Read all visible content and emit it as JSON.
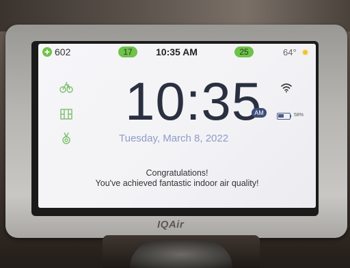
{
  "device": {
    "brand": "IQAir"
  },
  "status_bar": {
    "fan_icon": "fan-icon",
    "fan_speed": "602",
    "indoor_aqi": "17",
    "time": "10:35 AM",
    "outdoor_aqi": "25",
    "temperature": "64°",
    "weather_icon": "sun-icon",
    "accent_color": "#6fc24a"
  },
  "mode_icons": [
    "eco-icon",
    "room-icon",
    "award-icon"
  ],
  "clock": {
    "time": "10:35",
    "ampm": "AM",
    "date": "Tuesday, March 8, 2022"
  },
  "indicators": {
    "wifi_icon": "wifi-icon",
    "battery_icon": "battery-icon",
    "battery_percent": "58%",
    "battery_level": 0.58
  },
  "message": {
    "line1": "Congratulations!",
    "line2": "You've achieved fantastic indoor air quality!"
  }
}
